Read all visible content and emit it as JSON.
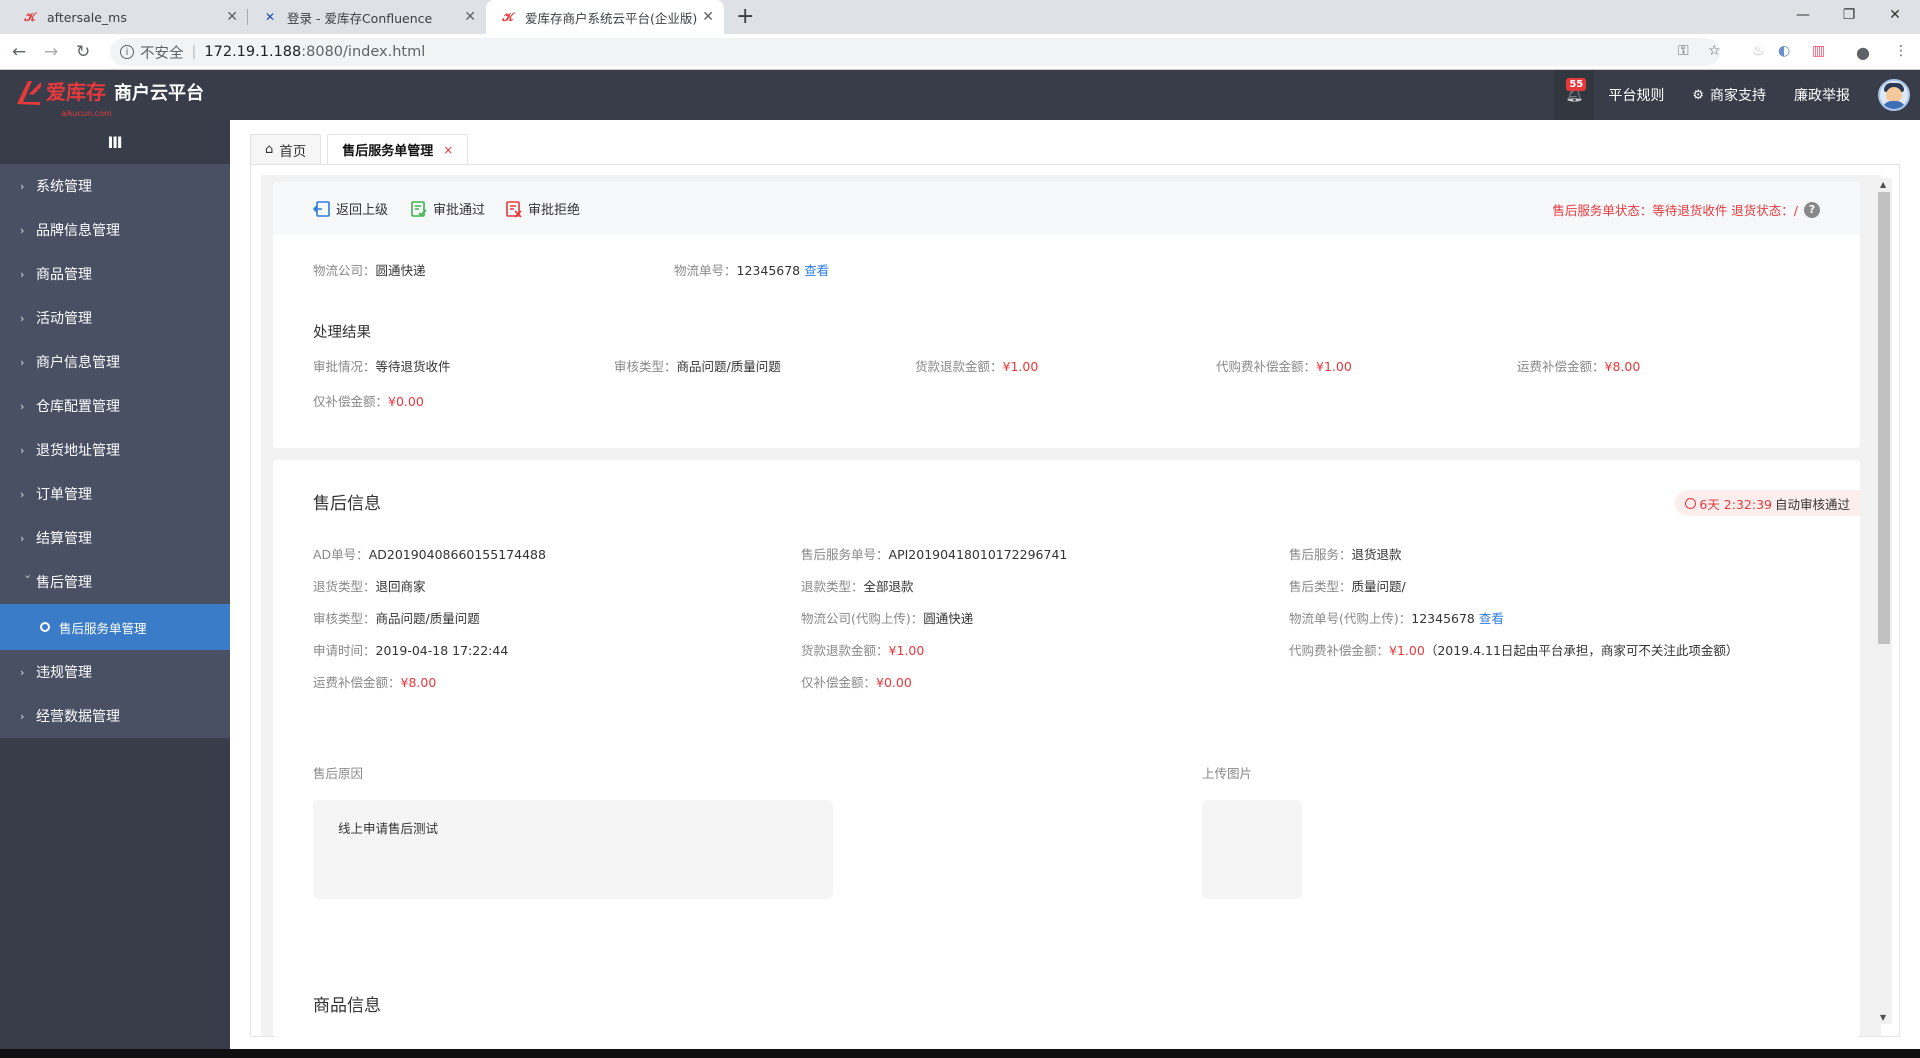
{
  "browser": {
    "tabs": [
      {
        "title": "aftersale_ms",
        "icon": "aikucun-logo-icon"
      },
      {
        "title": "登录 - 爱库存Confluence",
        "icon": "confluence-icon"
      },
      {
        "title": "爱库存商户系统云平台(企业版)",
        "icon": "aikucun-logo-icon"
      }
    ],
    "new_tab": "+",
    "security_label": "不安全",
    "url_host": "172.19.1.188",
    "url_path": ":8080/index.html"
  },
  "header": {
    "brand": "爱库存",
    "brand_sub": "aikucun.com",
    "platform": "商户云平台",
    "notifications": "55",
    "links": [
      "平台规则",
      "商家支持",
      "廉政举报"
    ]
  },
  "sidebar": {
    "toggle": "Ⅲ",
    "items": [
      {
        "label": "系统管理"
      },
      {
        "label": "品牌信息管理"
      },
      {
        "label": "商品管理"
      },
      {
        "label": "活动管理"
      },
      {
        "label": "商户信息管理"
      },
      {
        "label": "仓库配置管理"
      },
      {
        "label": "退货地址管理"
      },
      {
        "label": "订单管理"
      },
      {
        "label": "结算管理"
      },
      {
        "label": "售后管理",
        "open": true
      }
    ],
    "sub_item": "售后服务单管理",
    "items_after": [
      {
        "label": "违规管理"
      },
      {
        "label": "经营数据管理"
      }
    ]
  },
  "page_tabs": {
    "home": "首页",
    "current": "售后服务单管理",
    "close": "×"
  },
  "toolbar": {
    "back": "返回上级",
    "approve": "审批通过",
    "reject": "审批拒绝",
    "status": "售后服务单状态：等待退货收件 退货状态：/",
    "help": "?"
  },
  "logistics": {
    "company_label": "物流公司：",
    "company": "圆通快递",
    "number_label": "物流单号：",
    "number": "12345678",
    "view": "查看"
  },
  "result": {
    "title": "处理结果",
    "audit_label": "审批情况：",
    "audit": "等待退货收件",
    "type_label": "审核类型：",
    "type": "商品问题/质量问题",
    "refund_label": "货款退款金额：",
    "refund": "¥1.00",
    "purchase_label": "代购费补偿金额：",
    "purchase": "¥1.00",
    "freight_label": "运费补偿金额：",
    "freight": "¥8.00",
    "only_label": "仅补偿金额：",
    "only": "¥0.00"
  },
  "aftersale": {
    "title": "售后信息",
    "timer": "6天 2:32:39",
    "timer_suffix": "自动审核通过",
    "ad_label": "AD单号：",
    "ad": "AD20190408660155174488",
    "api_label": "售后服务单号：",
    "api": "API20190418010172296741",
    "service_label": "售后服务：",
    "service": "退货退款",
    "return_type_label": "退货类型：",
    "return_type": "退回商家",
    "refund_type_label": "退款类型：",
    "refund_type": "全部退款",
    "as_type_label": "售后类型：",
    "as_type": "质量问题/",
    "audit_type_label": "审核类型：",
    "audit_type": "商品问题/质量问题",
    "lc_label": "物流公司(代购上传)：",
    "lc": "圆通快递",
    "ln_label": "物流单号(代购上传)：",
    "ln": "12345678",
    "ln_view": "查看",
    "time_label": "申请时间：",
    "time": "2019-04-18 17:22:44",
    "refund_amt_label": "货款退款金额：",
    "refund_amt": "¥1.00",
    "purchase_label": "代购费补偿金额：",
    "purchase": "¥1.00",
    "purchase_note": "（2019.4.11日起由平台承担，商家可不关注此项金额）",
    "freight_label": "运费补偿金额：",
    "freight": "¥8.00",
    "only_label": "仅补偿金额：",
    "only": "¥0.00",
    "reason_label": "售后原因",
    "reason": "线上申请售后测试",
    "upload_label": "上传图片"
  },
  "goods": {
    "title": "商品信息"
  }
}
